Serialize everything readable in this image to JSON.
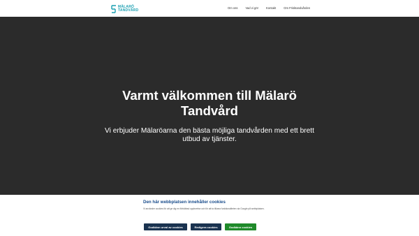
{
  "header": {
    "logo": {
      "line1": "MÄLARÖ",
      "line2": "TANDVÅRD",
      "color": "#1a9fb1"
    },
    "nav": [
      "Om oss",
      "Vad vi gör",
      "Kontakt",
      "Om Frisktandvården"
    ]
  },
  "hero": {
    "title": "Varmt välkommen till Mälarö Tandvård",
    "subtitle": "Vi erbjuder Mälaröarna den bästa möjliga tandvården med ett brett utbud av tjänster.",
    "background": "#2b2b2b"
  },
  "cookie_banner": {
    "title": "Den här webbplatsen innehåller cookies",
    "text": "Vi använder cookies för att ge dig en förbättrad upplevelse och för att ta tillvara funktionaliteten via Google på webbplatsen.",
    "buttons": {
      "accept_selection": "Godkänn urval av cookies",
      "edit": "Redigera cookies",
      "accept_all": "Godkänn cookies"
    },
    "colors": {
      "title": "#1a4d8c",
      "primary_button": "#1a3350",
      "accept_button": "#1f8a2a"
    }
  }
}
